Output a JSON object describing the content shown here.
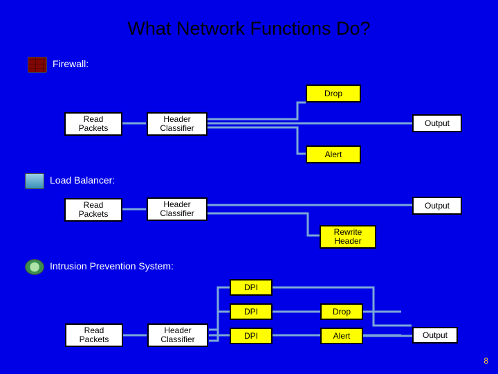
{
  "slide": {
    "title": "What Network Functions Do?",
    "page_number": "8"
  },
  "colors": {
    "background": "#0000e6",
    "box_white": "#ffffff",
    "box_yellow": "#ffff00",
    "border": "#000000",
    "connector": "#7aa7d8",
    "page_num": "#ffcc33"
  },
  "sections": {
    "firewall": {
      "label": "Firewall:",
      "icon": "firewall-icon",
      "boxes": {
        "read": "Read\nPackets",
        "classifier": "Header\nClassifier",
        "drop": "Drop",
        "alert": "Alert",
        "output": "Output"
      }
    },
    "lb": {
      "label": "Load Balancer:",
      "icon": "load-balancer-icon",
      "boxes": {
        "read": "Read\nPackets",
        "classifier": "Header\nClassifier",
        "rewrite": "Rewrite\nHeader",
        "output": "Output"
      }
    },
    "ips": {
      "label": "Intrusion Prevention System:",
      "icon": "ips-icon",
      "boxes": {
        "read": "Read\nPackets",
        "classifier": "Header\nClassifier",
        "dpi1": "DPI",
        "dpi2": "DPI",
        "dpi3": "DPI",
        "drop": "Drop",
        "alert": "Alert",
        "output": "Output"
      }
    }
  }
}
